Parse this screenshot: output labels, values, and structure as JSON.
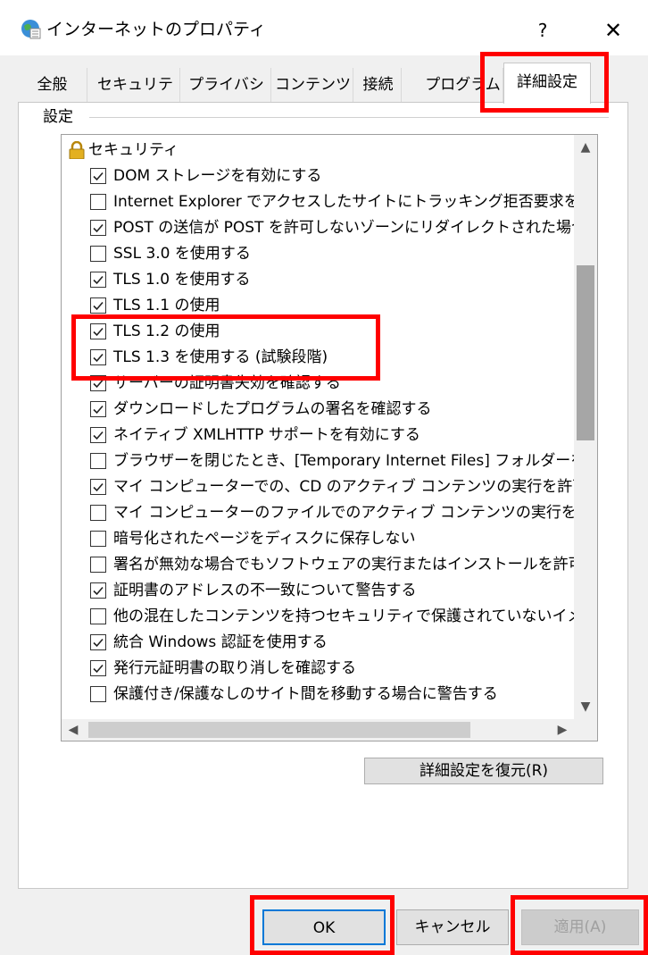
{
  "window": {
    "title": "インターネットのプロパティ",
    "help_glyph": "?",
    "close_glyph": "✕"
  },
  "tabs": [
    {
      "label": "全般"
    },
    {
      "label": "セキュリティ"
    },
    {
      "label": "プライバシー"
    },
    {
      "label": "コンテンツ"
    },
    {
      "label": "接続"
    },
    {
      "label": "プログラム"
    },
    {
      "label": "詳細設定",
      "active": true
    }
  ],
  "settings": {
    "group_label": "設定",
    "category": "セキュリティ",
    "items": [
      {
        "label": "DOM ストレージを有効にする",
        "checked": true
      },
      {
        "label": "Internet Explorer でアクセスしたサイトにトラッキング拒否要求を送",
        "checked": false
      },
      {
        "label": "POST の送信が POST を許可しないゾーンにリダイレクトされた場合",
        "checked": true
      },
      {
        "label": "SSL 3.0 を使用する",
        "checked": false
      },
      {
        "label": "TLS 1.0 を使用する",
        "checked": true
      },
      {
        "label": "TLS 1.1 の使用",
        "checked": true
      },
      {
        "label": "TLS 1.2 の使用",
        "checked": true
      },
      {
        "label": "TLS 1.3 を使用する (試験段階)",
        "checked": true
      },
      {
        "label": "サーバーの証明書失効を確認する",
        "checked": true
      },
      {
        "label": "ダウンロードしたプログラムの署名を確認する",
        "checked": true
      },
      {
        "label": "ネイティブ XMLHTTP サポートを有効にする",
        "checked": true
      },
      {
        "label": "ブラウザーを閉じたとき、[Temporary Internet Files] フォルダーを空",
        "checked": false
      },
      {
        "label": "マイ コンピューターでの、CD のアクティブ コンテンツの実行を許可する",
        "checked": true
      },
      {
        "label": "マイ コンピューターのファイルでのアクティブ コンテンツの実行を許可す",
        "checked": false
      },
      {
        "label": "暗号化されたページをディスクに保存しない",
        "checked": false
      },
      {
        "label": "署名が無効な場合でもソフトウェアの実行またはインストールを許可",
        "checked": false
      },
      {
        "label": "証明書のアドレスの不一致について警告する",
        "checked": true
      },
      {
        "label": "他の混在したコンテンツを持つセキュリティで保護されていないイメージ",
        "checked": false
      },
      {
        "label": "統合 Windows 認証を使用する",
        "checked": true
      },
      {
        "label": "発行元証明書の取り消しを確認する",
        "checked": true
      },
      {
        "label": "保護付き/保護なしのサイト間を移動する場合に警告する",
        "checked": false
      }
    ],
    "restore_button": "詳細設定を復元(R)"
  },
  "buttons": {
    "ok": "OK",
    "cancel": "キャンセル",
    "apply": "適用(A)"
  },
  "colors": {
    "highlight": "#ff0000",
    "ok_focus": "#0078d7"
  }
}
